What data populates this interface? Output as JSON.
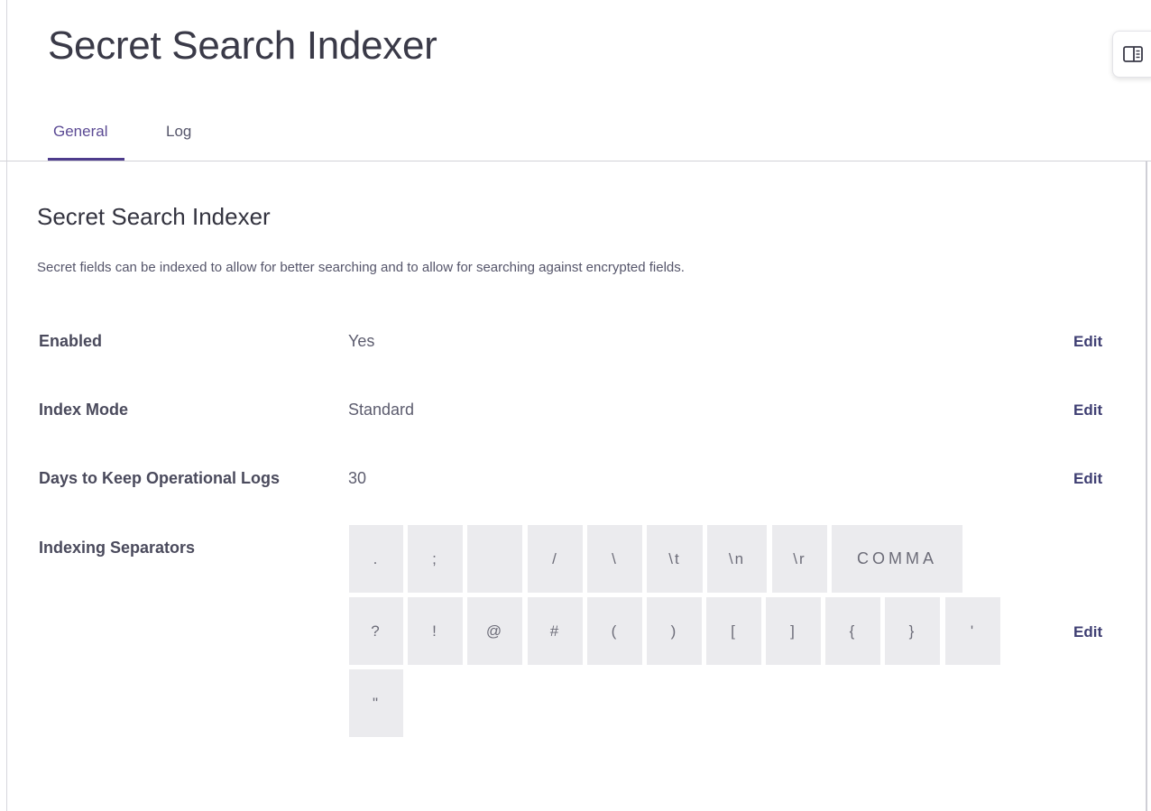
{
  "header": {
    "title": "Secret Search Indexer",
    "panel_toggle_icon": "sidebar-panel-icon"
  },
  "tabs": [
    {
      "label": "General",
      "active": true
    },
    {
      "label": "Log",
      "active": false
    }
  ],
  "section": {
    "title": "Secret Search Indexer",
    "description": "Secret fields can be indexed to allow for better searching and to allow for searching against encrypted fields."
  },
  "settings": {
    "enabled": {
      "label": "Enabled",
      "value": "Yes",
      "edit": "Edit"
    },
    "index_mode": {
      "label": "Index Mode",
      "value": "Standard",
      "edit": "Edit"
    },
    "days_logs": {
      "label": "Days to Keep Operational Logs",
      "value": "30",
      "edit": "Edit"
    },
    "separators": {
      "label": "Indexing Separators",
      "edit": "Edit",
      "items": [
        ".",
        ";",
        " ",
        "/",
        "\\",
        "\\t",
        "\\n",
        "\\r",
        "COMMA",
        "?",
        "!",
        "@",
        "#",
        "(",
        ")",
        "[",
        "]",
        "{",
        "}",
        "'",
        "\""
      ]
    }
  },
  "colors": {
    "accent": "#4e3c8c",
    "chip_background": "#ebebee",
    "edit_link": "#3e3e72"
  }
}
